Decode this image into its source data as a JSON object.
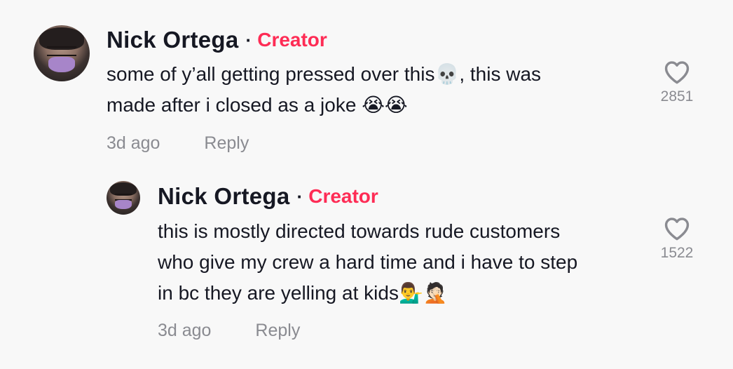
{
  "comments": [
    {
      "username": "Nick Ortega",
      "separator": "·",
      "badge": "Creator",
      "text_line1": "some of y’all getting pressed over this💀, this was",
      "text_line2": "made after i closed as a joke 😭😭",
      "time": "3d ago",
      "reply_label": "Reply",
      "like_icon": "heart-outline-icon",
      "likes": "2851"
    },
    {
      "username": "Nick Ortega",
      "separator": "·",
      "badge": "Creator",
      "text_line1": "this is mostly directed towards rude customers",
      "text_line2": "who give my crew a hard time and i have to step",
      "text_line3": "in bc they are yelling at kids💁‍♂️🤦🏻",
      "time": "3d ago",
      "reply_label": "Reply",
      "like_icon": "heart-outline-icon",
      "likes": "1522"
    }
  ],
  "colors": {
    "background": "#f8f8f8",
    "creator_badge": "#fe2c55",
    "text_primary": "#161823",
    "text_secondary": "#8a8b91"
  }
}
